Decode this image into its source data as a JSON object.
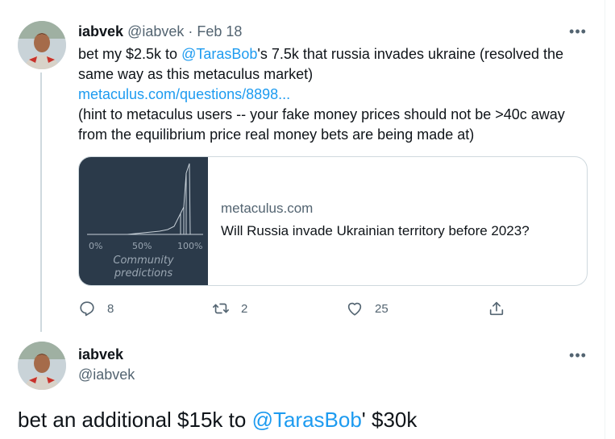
{
  "tweet1": {
    "name": "iabvek",
    "handle": "@iabvek",
    "separator": "·",
    "date": "Feb 18",
    "more": "•••",
    "text_part1": "bet my $2.5k to ",
    "mention": "@TarasBob",
    "text_part2": "'s 7.5k that russia invades ukraine (resolved the same way as this metaculus market)",
    "link": "metaculus.com/questions/8898...",
    "text_part3": "(hint to metaculus users -- your fake money prices should not be >40c away from the equilibrium price real money bets are being made at)",
    "card": {
      "domain": "metaculus.com",
      "title": "Will Russia invade Ukrainian territory before 2023?",
      "thumb_tick_0": "0%",
      "thumb_tick_50": "50%",
      "thumb_tick_100": "100%",
      "thumb_caption_1": "Community",
      "thumb_caption_2": "predictions"
    },
    "actions": {
      "replies": "8",
      "retweets": "2",
      "likes": "25"
    }
  },
  "tweet2": {
    "name": "iabvek",
    "handle": "@iabvek",
    "more": "•••",
    "text_part1": "bet an additional $15k to ",
    "mention": "@TarasBob",
    "text_part2": "' $30k"
  },
  "colors": {
    "link": "#1d9bf0",
    "muted": "#536471",
    "text": "#0f1419",
    "thumb_bg": "#2b3a4a"
  },
  "icons": {
    "reply": "reply-icon",
    "retweet": "retweet-icon",
    "like": "heart-icon",
    "share": "share-icon",
    "more": "more-dots-icon"
  }
}
